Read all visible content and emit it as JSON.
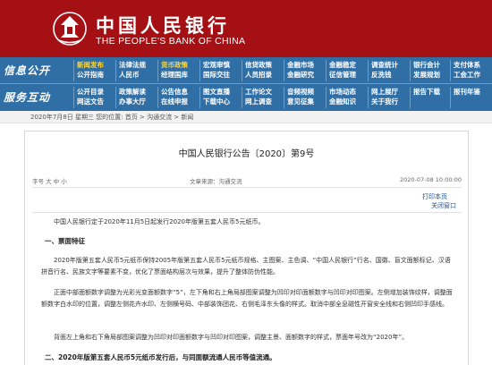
{
  "header": {
    "title_cn": "中国人民银行",
    "title_en": "THE PEOPLE'S BANK OF CHINA",
    "emblem_icon": "bank-emblem-icon",
    "color": "#a51014"
  },
  "nav": {
    "rows": [
      {
        "label": "信息公开",
        "cells": [
          {
            "top": "新闻发布",
            "bottom": "法律法规",
            "top_alt": "公开指南"
          },
          {
            "top": "法律法规",
            "bottom": "人民币"
          },
          {
            "top": "货币政策",
            "bottom": "经理国库"
          },
          {
            "top": "宏观审慎",
            "bottom": "国际交往"
          },
          {
            "top": "信贷政策",
            "bottom": "人员招录"
          },
          {
            "top": "金融市场",
            "bottom": "金融研究"
          },
          {
            "top": "金融稳定",
            "bottom": "征信管理"
          },
          {
            "top": "调查统计",
            "bottom": "反洗钱"
          },
          {
            "top": "银行会计",
            "bottom": "发展规划"
          },
          {
            "top": "支付体系",
            "bottom": "工会工作"
          }
        ]
      },
      {
        "label": "服务互动",
        "cells": [
          {
            "top": "公开目录",
            "bottom": "网送文告"
          },
          {
            "top": "政策解读",
            "bottom": "办事大厅"
          },
          {
            "top": "公告信息",
            "bottom": "在线申报"
          },
          {
            "top": "图文直播",
            "bottom": "下载中心"
          },
          {
            "top": "工作论文",
            "bottom": "网上调查"
          },
          {
            "top": "音频视频",
            "bottom": "意见征集"
          },
          {
            "top": "市场动态",
            "bottom": "金融知识"
          },
          {
            "top": "网上展厅",
            "bottom": "关于我行"
          },
          {
            "top": "报告下载",
            "bottom": ""
          },
          {
            "top": "报刊年鉴",
            "bottom": ""
          }
        ]
      }
    ],
    "color": "#2f6fa6"
  },
  "breadcrumb": {
    "text": "2020年7月8日 星期三 您的位置: 首页 > 沟通交流 > 新闻"
  },
  "article": {
    "title": "中国人民银行公告〔2020〕第9号",
    "source": "字号 大 中 小",
    "column": "文章来源：沟通交流",
    "date": "2020-07-08 10:00:00",
    "print": "打印本页",
    "close": "关闭窗口",
    "paragraphs": [
      {
        "kind": "p",
        "text": "中国人民银行定于2020年11月5日起发行2020年版第五套人民币5元纸币。"
      },
      {
        "kind": "h",
        "text": "一、票面特征"
      },
      {
        "kind": "p",
        "text": "2020年版第五套人民币5元纸币保持2005年版第五套人民币5元纸币规格、主图案、主色调、“中国人民银行”行名、国徽、盲文面额标记、汉语拼音行名、民族文字等要素不变，优化了票面结构层次与效果，提升了整体防伪性能。"
      },
      {
        "kind": "p",
        "text": "正面中部面额数字调整为光彩光变面额数字“5”，左下角和右上角局部图案调整为凹印对印面额数字与凹印对印图案。左侧增加装饰纹样，调整面额数字白水印的位置，调整左侧花卉水印、左侧横号码、中部装饰团花、右侧毛泽东头像的样式。取消中部全息磁性开窗安全线和右侧凹印手感线。"
      },
      {
        "kind": "p",
        "text": "背面左上角和右下角局部图案调整为凹印对印面额数字与凹印对印图案，调整主景、面额数字的样式，票面年号改为“2020年”。"
      },
      {
        "kind": "h",
        "text": "二、2020年版第五套人民币5元纸币发行后，与同面额流通人民币等值流通。"
      }
    ]
  }
}
